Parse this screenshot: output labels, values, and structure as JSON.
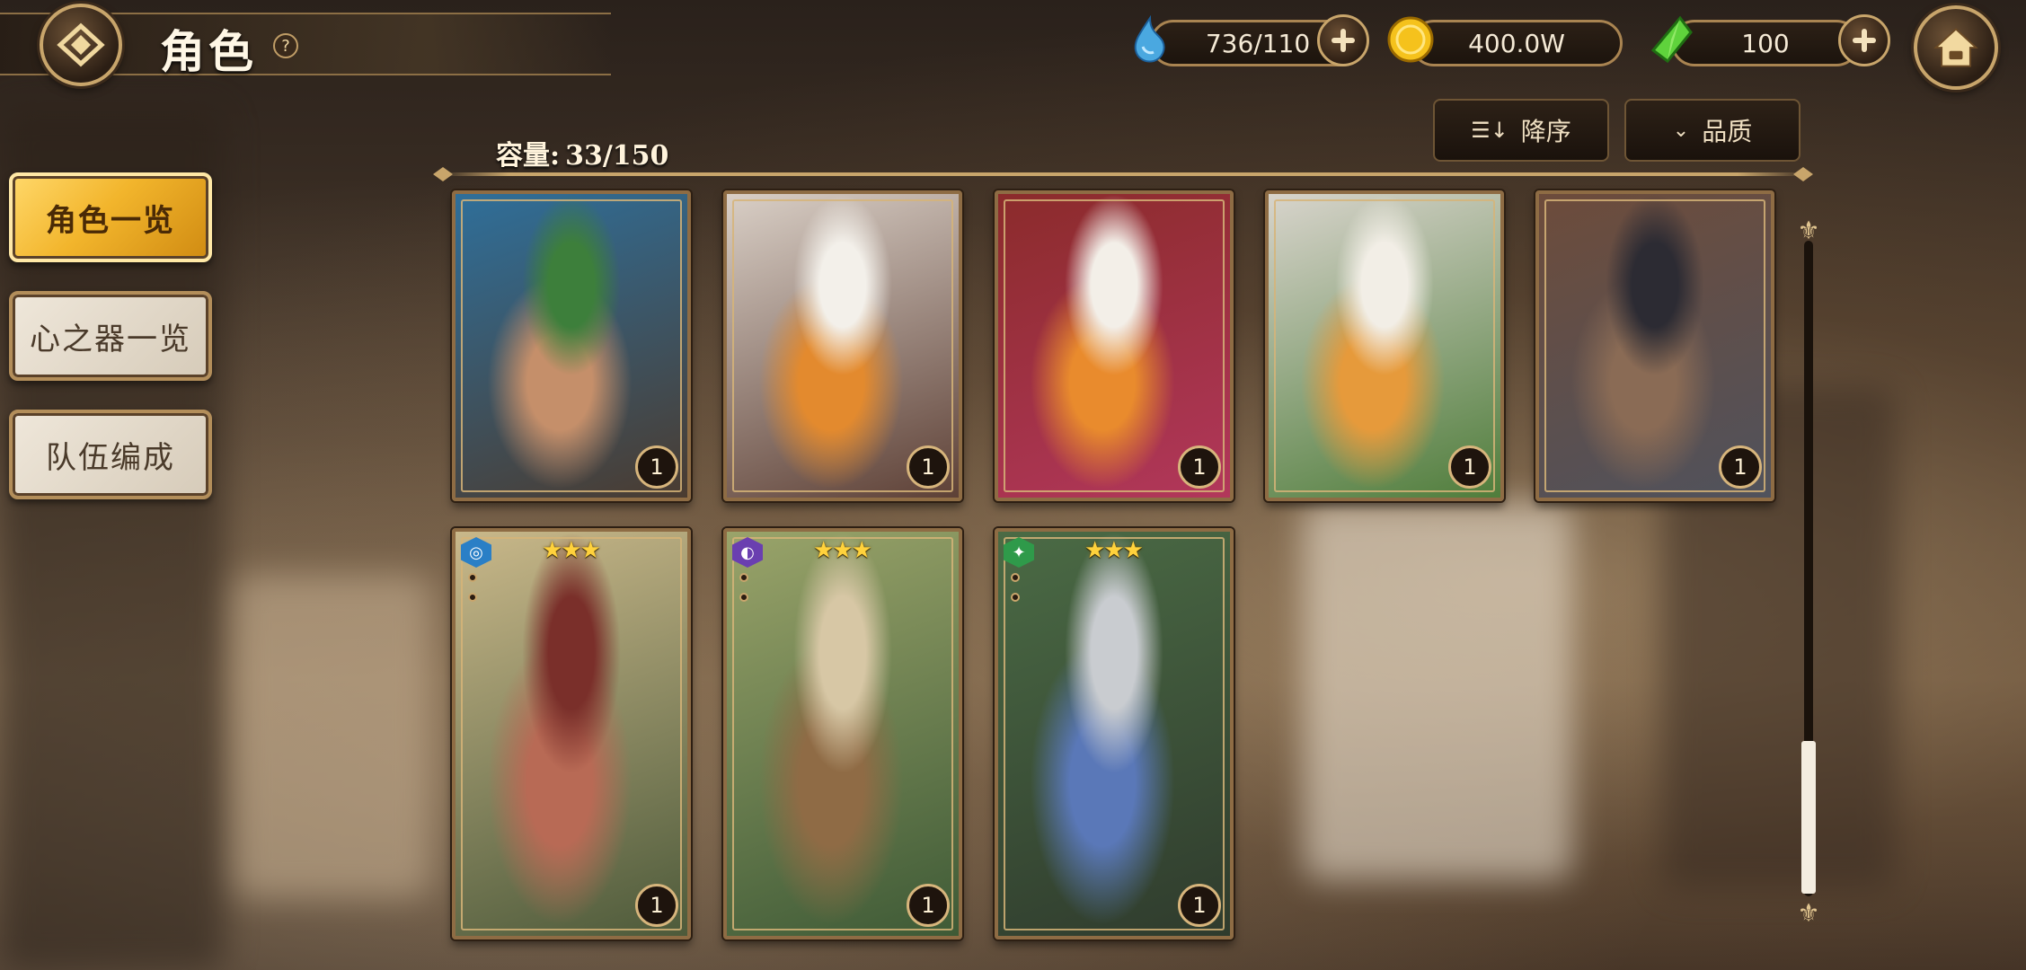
{
  "header": {
    "title": "角色",
    "help": "?"
  },
  "currencies": {
    "stamina": {
      "value": "736/110",
      "icon": "water-drop-icon"
    },
    "gold": {
      "value": "400.0W",
      "icon": "gold-coin-icon"
    },
    "gem": {
      "value": "100",
      "icon": "green-crystal-icon"
    }
  },
  "menu": {
    "items": [
      {
        "label": "角色一览",
        "active": true
      },
      {
        "label": "心之器一览",
        "active": false
      },
      {
        "label": "队伍编成",
        "active": false
      }
    ]
  },
  "toolbar": {
    "sort_label": "降序",
    "filter_label": "品质",
    "capacity_label": "容量:",
    "capacity_value": "33/150"
  },
  "cards": [
    {
      "level": "1",
      "stars": "",
      "element": "",
      "palette": [
        "#2f6f9a",
        "#3d7f3b",
        "#c58f6a",
        "#4a3b30"
      ]
    },
    {
      "level": "1",
      "stars": "",
      "element": "",
      "palette": [
        "#d9cfc6",
        "#f3f0ea",
        "#e38a2e",
        "#5d4036"
      ]
    },
    {
      "level": "1",
      "stars": "",
      "element": "",
      "palette": [
        "#8b2b2b",
        "#f3efe8",
        "#e98b2d",
        "#b2375b"
      ]
    },
    {
      "level": "1",
      "stars": "",
      "element": "",
      "palette": [
        "#d8d4cc",
        "#f2eee6",
        "#e69a3b",
        "#4f7d3b"
      ]
    },
    {
      "level": "1",
      "stars": "",
      "element": "",
      "palette": [
        "#6d4c3b",
        "#2c2b33",
        "#8a6b55",
        "#50525c"
      ]
    },
    {
      "level": "1",
      "stars": "★★★",
      "element": "water",
      "palette": [
        "#c9b88a",
        "#7a2f2a",
        "#b86a55",
        "#4d5a3a"
      ]
    },
    {
      "level": "1",
      "stars": "★★★",
      "element": "dark",
      "palette": [
        "#9aa46a",
        "#d7c7a5",
        "#8f6b45",
        "#3e5a36"
      ]
    },
    {
      "level": "1",
      "stars": "★★★",
      "element": "wind",
      "palette": [
        "#4b6b45",
        "#c9ccd0",
        "#5a78b8",
        "#2f3b2d"
      ]
    }
  ]
}
